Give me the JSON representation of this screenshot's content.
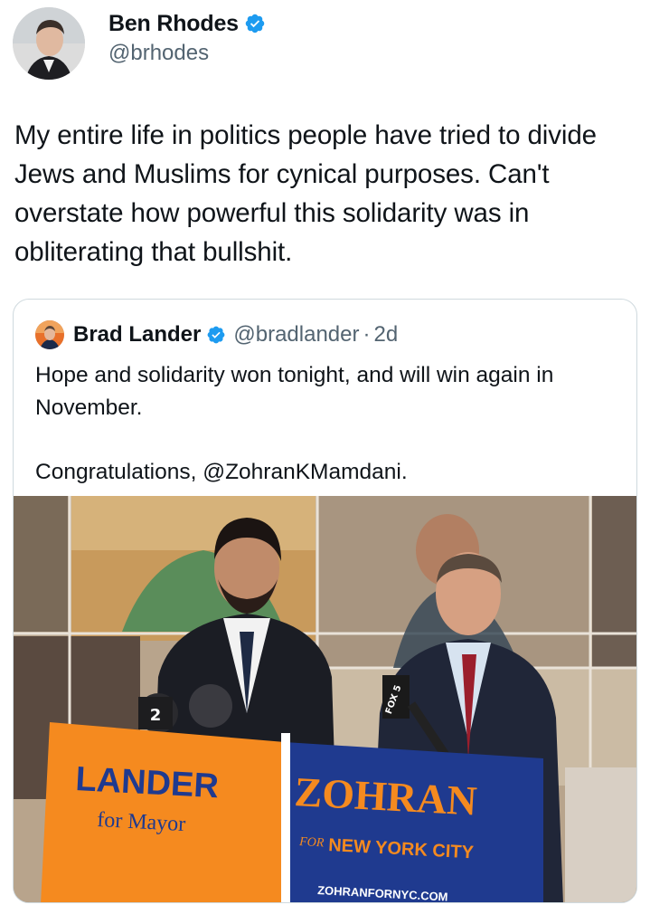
{
  "tweet": {
    "author_name": "Ben Rhodes",
    "author_handle": "@brhodes",
    "text": "My entire life in politics people have tried to divide Jews and Muslims for cynical purposes. Can't overstate how powerful this solidarity was in obliterating that bullshit."
  },
  "quoted": {
    "author_name": "Brad Lander",
    "author_handle": "@bradlander",
    "separator": "·",
    "time": "2d",
    "text_line1": "Hope and solidarity won tonight, and will win again in November.",
    "text_line2": "Congratulations, @ZohranKMamdani."
  },
  "photo": {
    "sign_left_title": "LANDER",
    "sign_left_sub": "for Mayor",
    "sign_right_title": "ZOHRAN",
    "sign_right_for": "FOR",
    "sign_right_city": "NEW YORK CITY",
    "sign_right_url": "ZOHRANFORNYC.COM",
    "mic_left": "2",
    "mic_right": "FOX 5"
  },
  "colors": {
    "verified": "#1d9bf0",
    "text": "#0f1419",
    "secondary": "#536471",
    "border": "#cfd9de",
    "sign_orange": "#f58a1f",
    "sign_blue": "#1f3a8f"
  },
  "icons": {
    "verified": "verified-badge-icon"
  }
}
